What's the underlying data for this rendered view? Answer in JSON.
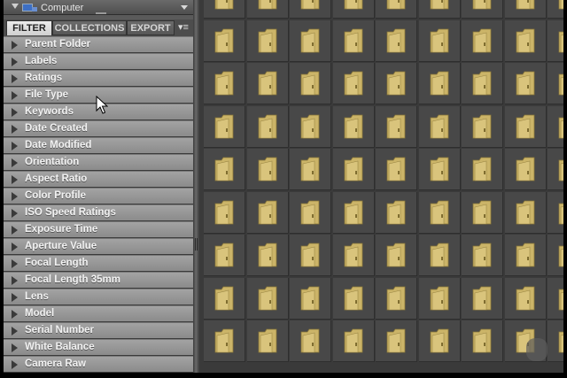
{
  "path_bar": {
    "location": "Computer"
  },
  "tabs": [
    {
      "id": "filter",
      "label": "FILTER",
      "active": true
    },
    {
      "id": "collections",
      "label": "COLLECTIONS",
      "active": false
    },
    {
      "id": "export",
      "label": "EXPORT",
      "active": false
    }
  ],
  "filter_categories": [
    "Parent Folder",
    "Labels",
    "Ratings",
    "File Type",
    "Keywords",
    "Date Created",
    "Date Modified",
    "Orientation",
    "Aspect Ratio",
    "Color Profile",
    "ISO Speed Ratings",
    "Exposure Time",
    "Aperture Value",
    "Focal Length",
    "Focal Length 35mm",
    "Lens",
    "Model",
    "Serial Number",
    "White Balance",
    "Camera Raw"
  ],
  "content_grid": {
    "item_type": "folder-icon"
  },
  "colors": {
    "panel_bg": "#5a5a5a",
    "row_gradient_top": "#a3a3a3",
    "row_gradient_bottom": "#8b8b8b",
    "grid_bg": "#3a3a3a",
    "folder": "#cbb468",
    "folder_front": "#d9c47c"
  }
}
